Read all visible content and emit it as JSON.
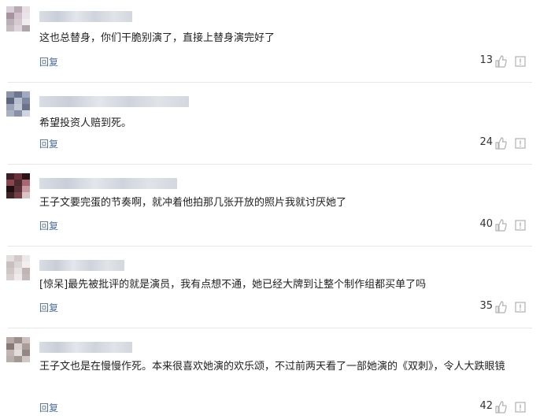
{
  "comments": [
    {
      "text": "这也总替身，你们干脆别演了，直接上替身演完好了",
      "reply_label": "回复",
      "likes": "13",
      "avatar_colors": [
        "#d8d0d6",
        "#b9a9b4",
        "#e6e0e4",
        "#a7939f",
        "#cfc2ca",
        "#e9e4e8",
        "#bcb0b8",
        "#d4cad0",
        "#f0edef",
        "#c8bcc3",
        "#ddd5da",
        "#b3a3ad"
      ]
    },
    {
      "text": "希望投资人赔到死。",
      "reply_label": "回复",
      "likes": "24",
      "avatar_colors": [
        "#8b93a8",
        "#6d7890",
        "#a2aac0",
        "#5d6680",
        "#b8bfcf",
        "#7e879e",
        "#9aa2b5",
        "#c4c9d6",
        "#6a7389",
        "#a9b0c2",
        "#8891a7",
        "#d0d4de"
      ]
    },
    {
      "text": "王子文要完蛋的节奏啊，就冲着他拍那几张开放的照片我就讨厌她了",
      "reply_label": "回复",
      "likes": "40",
      "avatar_colors": [
        "#3b1f24",
        "#6b3038",
        "#2a1418",
        "#8a4550",
        "#4d2a30",
        "#a66770",
        "#1f0f12",
        "#5a2f36",
        "#c59aa0",
        "#3f2227",
        "#744048",
        "#d8c4c7"
      ]
    },
    {
      "text": "[惊呆]最先被批评的就是演员，我有点想不通，她已经大牌到让整个制作组都买单了吗",
      "reply_label": "回复",
      "likes": "35",
      "avatar_colors": [
        "#e4dede",
        "#d2caca",
        "#eee9e9",
        "#c8bfbf",
        "#ddd6d6",
        "#f2efef",
        "#cfc6c6",
        "#e8e3e3",
        "#bfb5b5",
        "#d9d1d1",
        "#efebeb",
        "#c4baba"
      ]
    },
    {
      "text": "王子文也是在慢慢作死。本来很喜欢她演的欢乐颂，不过前两天看了一部她演的《双刺》，令人大跌眼镜",
      "reply_label": "回复",
      "likes": "42",
      "avatar_colors": [
        "#b5aaa6",
        "#9c8f8b",
        "#cbc2bf",
        "#877a76",
        "#d8d1cf",
        "#a89d99",
        "#c0b6b3",
        "#e2dcda",
        "#958884",
        "#b9afab",
        "#a3  9894",
        "#d0c8c5"
      ]
    }
  ],
  "colors": {
    "reply_link": "#4d6d9a",
    "icon_gray": "#b0b0b0"
  },
  "icons": {
    "like": "thumbs-up-icon",
    "report": "report-icon"
  }
}
